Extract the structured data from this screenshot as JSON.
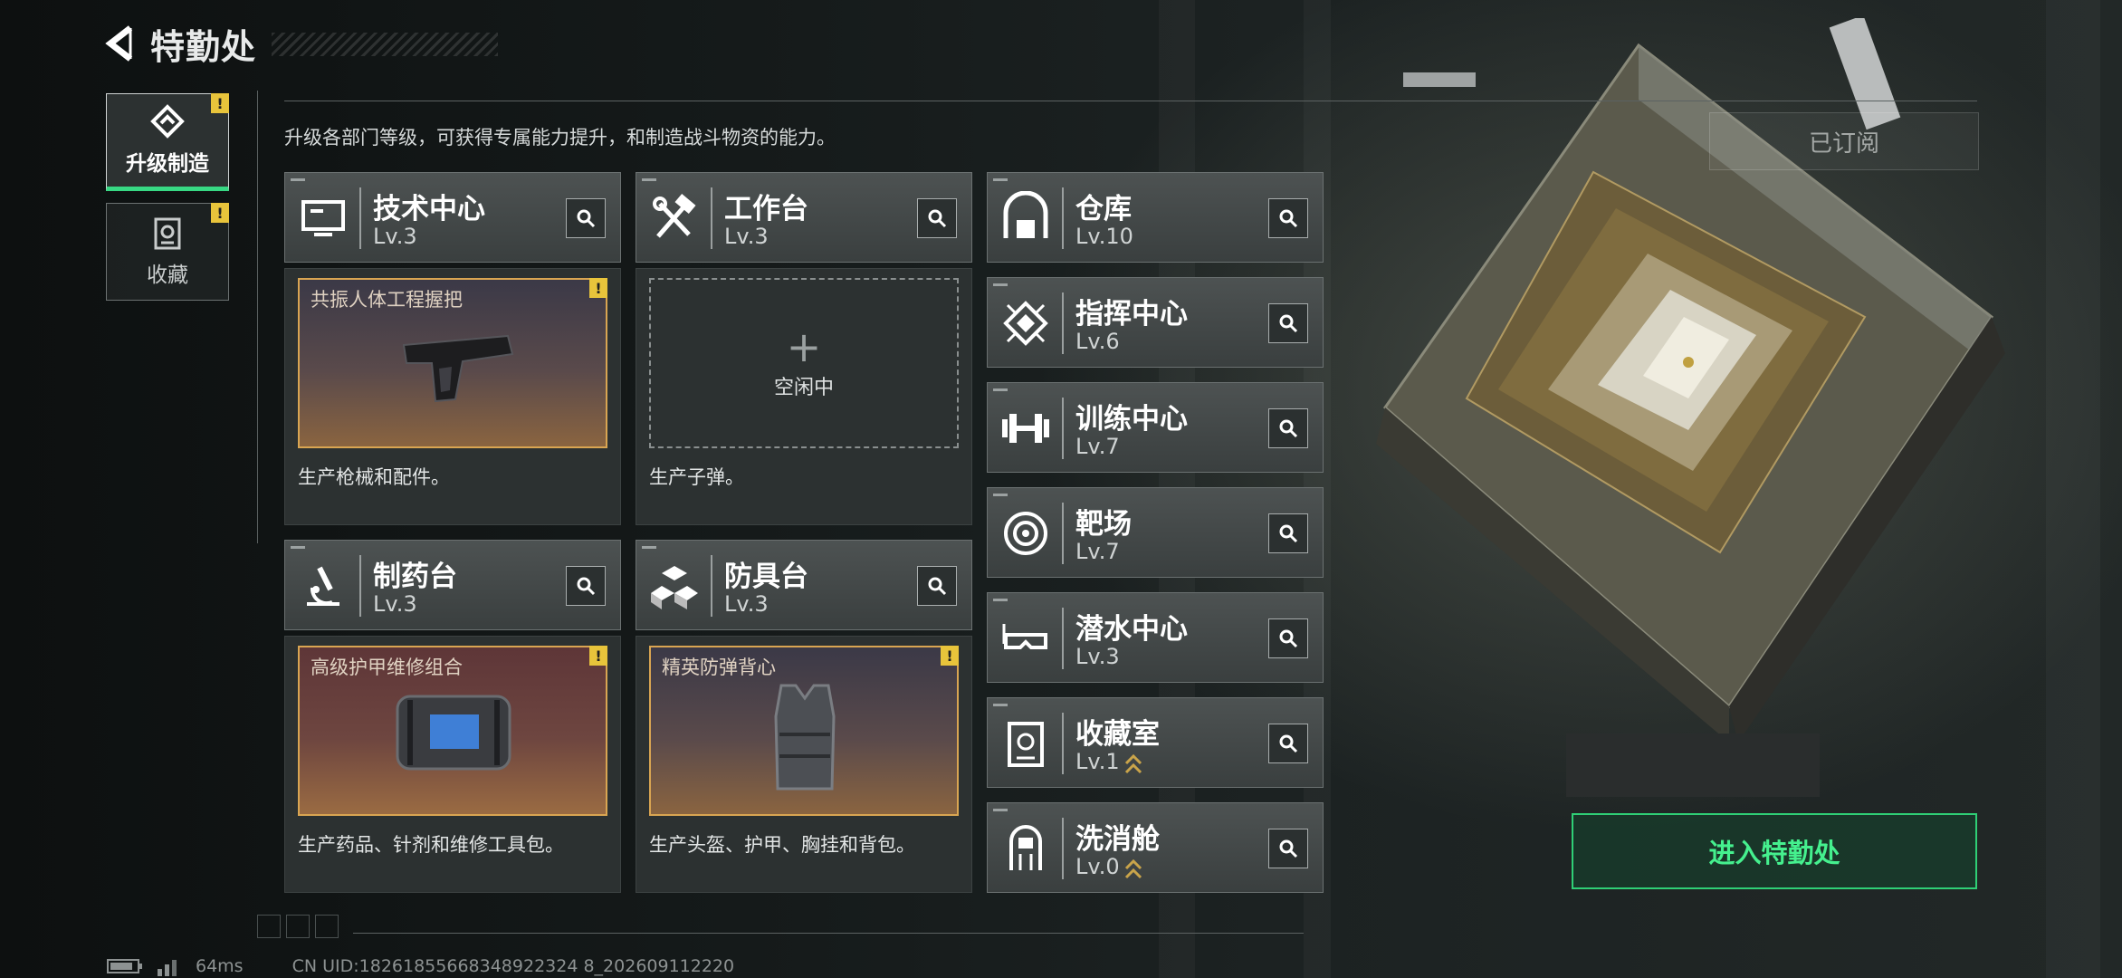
{
  "header": {
    "title": "特勤处"
  },
  "side_tabs": [
    {
      "label": "升级制造",
      "active": true,
      "badge": "!"
    },
    {
      "label": "收藏",
      "active": false,
      "badge": "!"
    }
  ],
  "description": "升级各部门等级，可获得专属能力提升，和制造战斗物资的能力。",
  "subscribe_button": "已订阅",
  "workshops": [
    {
      "name": "技术中心",
      "level": "Lv.3",
      "icon": "monitor-icon",
      "production": {
        "state": "item",
        "item_name": "共振人体工程握把",
        "badge": "!"
      },
      "desc": "生产枪械和配件。"
    },
    {
      "name": "工作台",
      "level": "Lv.3",
      "icon": "hammer-wrench-icon",
      "production": {
        "state": "empty",
        "plus": "+",
        "idle_label": "空闲中"
      },
      "desc": "生产子弹。"
    },
    {
      "name": "制药台",
      "level": "Lv.3",
      "icon": "microscope-icon",
      "production": {
        "state": "item",
        "item_name": "高级护甲维修组合",
        "badge": "!"
      },
      "desc": "生产药品、针剂和维修工具包。"
    },
    {
      "name": "防具台",
      "level": "Lv.3",
      "icon": "cubes-icon",
      "production": {
        "state": "item",
        "item_name": "精英防弹背心",
        "badge": "!"
      },
      "desc": "生产头盔、护甲、胸挂和背包。"
    }
  ],
  "facilities": [
    {
      "name": "仓库",
      "level": "Lv.10",
      "icon": "warehouse-icon"
    },
    {
      "name": "指挥中心",
      "level": "Lv.6",
      "icon": "chip-icon"
    },
    {
      "name": "训练中心",
      "level": "Lv.7",
      "icon": "dumbbell-icon"
    },
    {
      "name": "靶场",
      "level": "Lv.7",
      "icon": "target-icon"
    },
    {
      "name": "潜水中心",
      "level": "Lv.3",
      "icon": "diving-mask-icon"
    },
    {
      "name": "收藏室",
      "level": "Lv.1",
      "icon": "trophy-icon",
      "upgradable": true
    },
    {
      "name": "洗消舱",
      "level": "Lv.0",
      "icon": "hazmat-icon",
      "upgradable": true
    }
  ],
  "enter_button": "进入特勤处",
  "status": {
    "ping": "64ms",
    "uid": "CN UID:18261855668348922324 8_202609112220"
  },
  "colors": {
    "accent_green": "#37d883",
    "badge_yellow": "#e8c43b",
    "item_border": "#d9a552"
  }
}
